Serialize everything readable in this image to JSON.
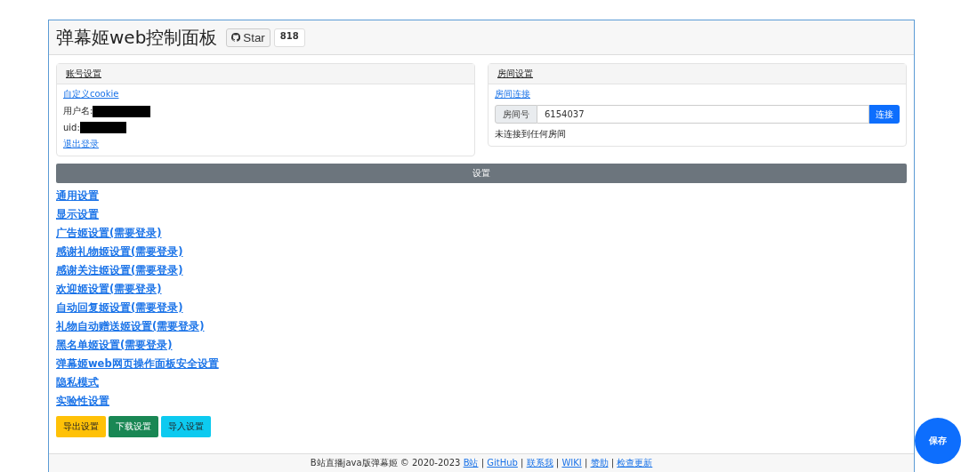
{
  "header": {
    "title": "弹幕姬web控制面板",
    "star_label": "Star",
    "star_count": "818"
  },
  "account": {
    "title": "账号设置",
    "cookie_link": "自定义cookie",
    "username_label": "用户名:",
    "uid_label": "uid:",
    "logout_link": "退出登录"
  },
  "room": {
    "title": "房间设置",
    "connect_link": "房间连接",
    "room_label": "房间号",
    "room_value": "6154037",
    "connect_button": "连接",
    "status": "未连接到任何房间"
  },
  "settings_bar": "设置",
  "settings_links": [
    "通用设置",
    "显示设置",
    "广告姬设置(需要登录)",
    "感谢礼物姬设置(需要登录)",
    "感谢关注姬设置(需要登录)",
    "欢迎姬设置(需要登录)",
    "自动回复姬设置(需要登录)",
    "礼物自动赠送姬设置(需要登录)",
    "黑名单姬设置(需要登录)",
    "弹幕姬web网页操作面板安全设置",
    "隐私模式",
    "实验性设置"
  ],
  "actions": [
    {
      "label": "导出设置",
      "kind": "warning"
    },
    {
      "label": "下载设置",
      "kind": "success"
    },
    {
      "label": "导入设置",
      "kind": "info"
    }
  ],
  "save_button": "保存",
  "footer": {
    "text": "B站直播java版弹幕姬 © 2020-2023",
    "separator": "|",
    "links": [
      "B站",
      "GitHub",
      "联系我",
      "WIKI",
      "赞助",
      "检查更新"
    ]
  }
}
